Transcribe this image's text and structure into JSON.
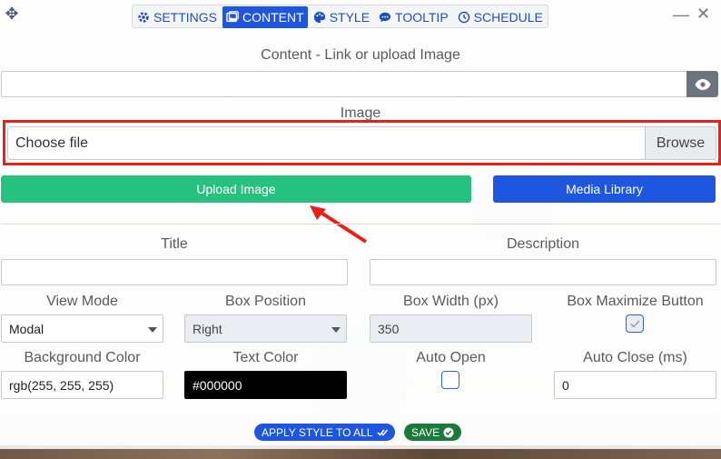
{
  "tabs": [
    {
      "label": "SETTINGS",
      "icon": "gear-icon"
    },
    {
      "label": "CONTENT",
      "icon": "images-icon"
    },
    {
      "label": "STYLE",
      "icon": "palette-icon"
    },
    {
      "label": "TOOLTIP",
      "icon": "comment-icon"
    },
    {
      "label": "SCHEDULE",
      "icon": "clock-icon"
    }
  ],
  "active_tab": "CONTENT",
  "content": {
    "link_label": "Content - Link or upload Image",
    "link_value": "",
    "image_label": "Image",
    "file_placeholder": "Choose file",
    "browse_label": "Browse",
    "upload_label": "Upload Image",
    "media_label": "Media Library"
  },
  "form": {
    "title_label": "Title",
    "title_value": "",
    "description_label": "Description",
    "description_value": "",
    "view_mode_label": "View Mode",
    "view_mode_value": "Modal",
    "box_position_label": "Box Position",
    "box_position_value": "Right",
    "box_width_label": "Box Width (px)",
    "box_width_value": "350",
    "box_max_label": "Box Maximize Button",
    "bg_color_label": "Background Color",
    "bg_color_value": "rgb(255, 255, 255)",
    "text_color_label": "Text Color",
    "text_color_value": "#000000",
    "auto_open_label": "Auto Open",
    "auto_close_label": "Auto Close (ms)",
    "auto_close_value": "0"
  },
  "footer": {
    "apply_label": "APPLY STYLE TO ALL",
    "save_label": "SAVE"
  },
  "colors": {
    "accent_blue": "#1f56e0",
    "upload_green": "#27c17f",
    "save_green": "#197a3a",
    "highlight_red": "#e8201a"
  }
}
